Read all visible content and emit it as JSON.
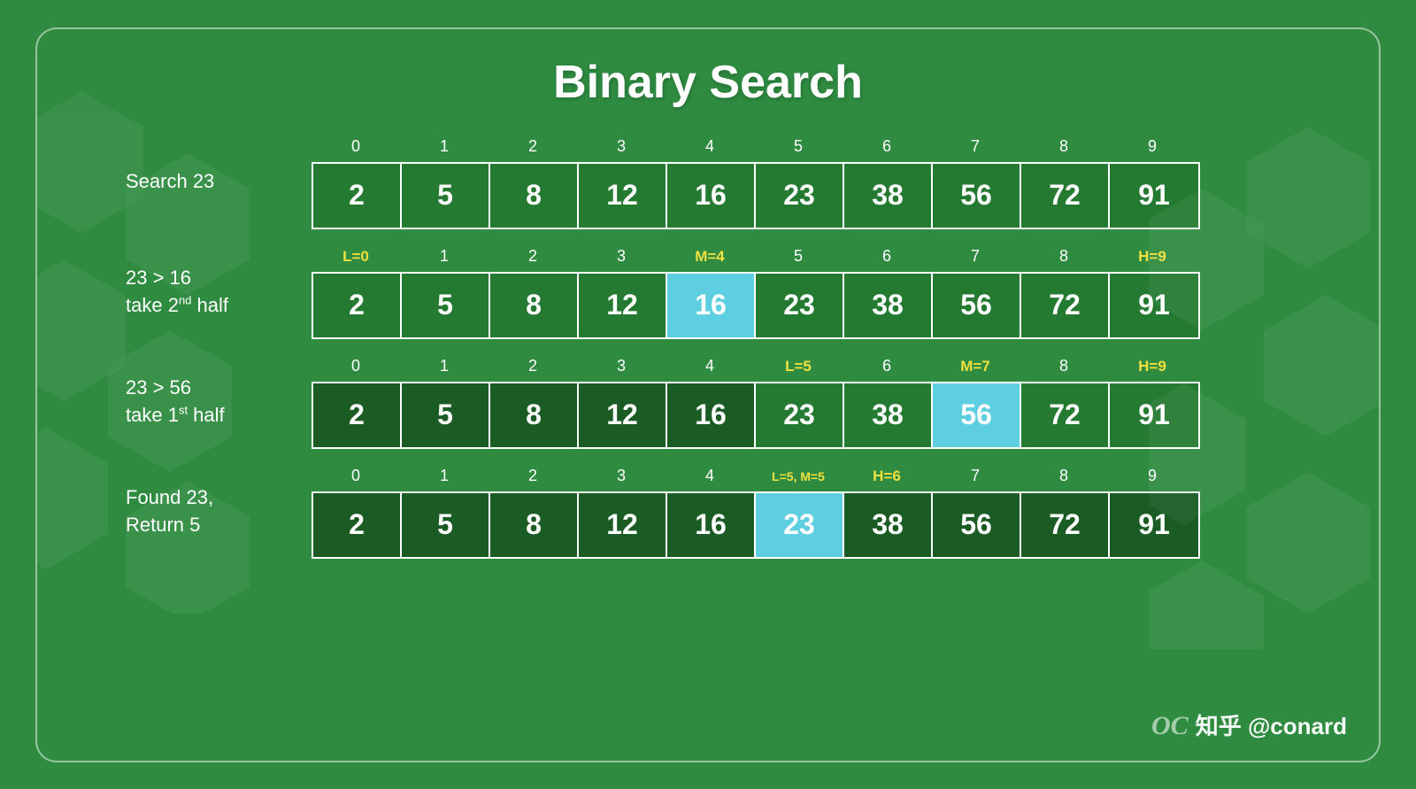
{
  "title": "Binary Search",
  "watermark": "知乎 @conard",
  "rows": [
    {
      "label": "Search 23",
      "label_html": "Search 23",
      "indices": [
        {
          "text": "0",
          "class": ""
        },
        {
          "text": "1",
          "class": ""
        },
        {
          "text": "2",
          "class": ""
        },
        {
          "text": "3",
          "class": ""
        },
        {
          "text": "4",
          "class": ""
        },
        {
          "text": "5",
          "class": ""
        },
        {
          "text": "6",
          "class": ""
        },
        {
          "text": "7",
          "class": ""
        },
        {
          "text": "8",
          "class": ""
        },
        {
          "text": "9",
          "class": ""
        }
      ],
      "cells": [
        {
          "value": "2",
          "type": "normal"
        },
        {
          "value": "5",
          "type": "normal"
        },
        {
          "value": "8",
          "type": "normal"
        },
        {
          "value": "12",
          "type": "normal"
        },
        {
          "value": "16",
          "type": "normal"
        },
        {
          "value": "23",
          "type": "normal"
        },
        {
          "value": "38",
          "type": "normal"
        },
        {
          "value": "56",
          "type": "normal"
        },
        {
          "value": "72",
          "type": "normal"
        },
        {
          "value": "91",
          "type": "normal"
        }
      ]
    },
    {
      "label": "23 > 16\ntake 2nd half",
      "label_html": "23 &gt; 16<br>take 2<sup>nd</sup> half",
      "indices": [
        {
          "text": "L=0",
          "class": "yellow"
        },
        {
          "text": "1",
          "class": ""
        },
        {
          "text": "2",
          "class": ""
        },
        {
          "text": "3",
          "class": ""
        },
        {
          "text": "M=4",
          "class": "yellow"
        },
        {
          "text": "5",
          "class": ""
        },
        {
          "text": "6",
          "class": ""
        },
        {
          "text": "7",
          "class": ""
        },
        {
          "text": "8",
          "class": ""
        },
        {
          "text": "H=9",
          "class": "yellow"
        }
      ],
      "cells": [
        {
          "value": "2",
          "type": "normal"
        },
        {
          "value": "5",
          "type": "normal"
        },
        {
          "value": "8",
          "type": "normal"
        },
        {
          "value": "12",
          "type": "normal"
        },
        {
          "value": "16",
          "type": "highlighted"
        },
        {
          "value": "23",
          "type": "normal"
        },
        {
          "value": "38",
          "type": "normal"
        },
        {
          "value": "56",
          "type": "normal"
        },
        {
          "value": "72",
          "type": "normal"
        },
        {
          "value": "91",
          "type": "normal"
        }
      ]
    },
    {
      "label": "23 > 56\ntake 1st half",
      "label_html": "23 &gt; 56<br>take 1<sup>st</sup> half",
      "indices": [
        {
          "text": "0",
          "class": ""
        },
        {
          "text": "1",
          "class": ""
        },
        {
          "text": "2",
          "class": ""
        },
        {
          "text": "3",
          "class": ""
        },
        {
          "text": "4",
          "class": ""
        },
        {
          "text": "L=5",
          "class": "yellow"
        },
        {
          "text": "6",
          "class": ""
        },
        {
          "text": "M=7",
          "class": "yellow"
        },
        {
          "text": "8",
          "class": ""
        },
        {
          "text": "H=9",
          "class": "yellow"
        }
      ],
      "cells": [
        {
          "value": "2",
          "type": "dark"
        },
        {
          "value": "5",
          "type": "dark"
        },
        {
          "value": "8",
          "type": "dark"
        },
        {
          "value": "12",
          "type": "dark"
        },
        {
          "value": "16",
          "type": "dark"
        },
        {
          "value": "23",
          "type": "normal"
        },
        {
          "value": "38",
          "type": "normal"
        },
        {
          "value": "56",
          "type": "highlighted"
        },
        {
          "value": "72",
          "type": "normal"
        },
        {
          "value": "91",
          "type": "normal"
        }
      ]
    },
    {
      "label": "Found 23,\nReturn 5",
      "label_html": "Found 23,<br>Return 5",
      "indices": [
        {
          "text": "0",
          "class": ""
        },
        {
          "text": "1",
          "class": ""
        },
        {
          "text": "2",
          "class": ""
        },
        {
          "text": "3",
          "class": ""
        },
        {
          "text": "4",
          "class": ""
        },
        {
          "text": "L=5, M=5",
          "class": "yellow"
        },
        {
          "text": "H=6",
          "class": "yellow"
        },
        {
          "text": "7",
          "class": ""
        },
        {
          "text": "8",
          "class": ""
        },
        {
          "text": "9",
          "class": ""
        }
      ],
      "cells": [
        {
          "value": "2",
          "type": "dark"
        },
        {
          "value": "5",
          "type": "dark"
        },
        {
          "value": "8",
          "type": "dark"
        },
        {
          "value": "12",
          "type": "dark"
        },
        {
          "value": "16",
          "type": "dark"
        },
        {
          "value": "23",
          "type": "highlighted"
        },
        {
          "value": "38",
          "type": "dark"
        },
        {
          "value": "56",
          "type": "dark"
        },
        {
          "value": "72",
          "type": "dark"
        },
        {
          "value": "91",
          "type": "dark"
        }
      ]
    }
  ]
}
